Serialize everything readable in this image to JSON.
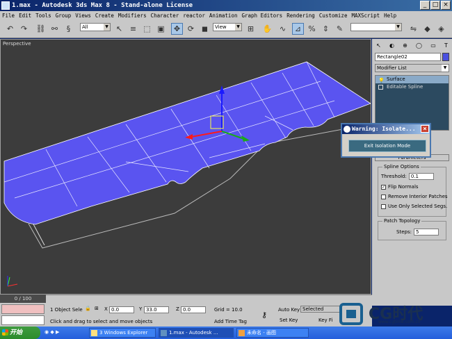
{
  "window": {
    "title": "1.max  - Autodesk 3ds Max 8  - Stand-alone License"
  },
  "menu": [
    "File",
    "Edit",
    "Tools",
    "Group",
    "Views",
    "Create",
    "Modifiers",
    "Character",
    "reactor",
    "Animation",
    "Graph Editors",
    "Rendering",
    "Customize",
    "MAXScript",
    "Help"
  ],
  "toolbar": {
    "selection_filter": "All",
    "ref_coord": "View"
  },
  "viewport": {
    "label": "Perspective"
  },
  "command_panel": {
    "object_name": "Rectangle02",
    "object_color": "#4a50e0",
    "modifier_list": "Modifier List",
    "stack": [
      "Surface",
      "Editable Spline"
    ],
    "rollout": "Parameters",
    "spline_options": {
      "title": "Spline Options",
      "threshold_label": "Threshold:",
      "threshold_value": "0.1",
      "flip_normals": "Flip Normals",
      "remove_interior": "Remove Interior Patches",
      "use_only_selected": "Use Only Selected Segs."
    },
    "patch_topology": {
      "title": "Patch Topology",
      "steps_label": "Steps:",
      "steps_value": "5"
    }
  },
  "dialog": {
    "title": "Warning: Isolate...",
    "button": "Exit Isolation Mode"
  },
  "status": {
    "time": "0 / 100",
    "selection": "1 Object Sele",
    "x_label": "X",
    "x": "0.0",
    "y_label": "Y",
    "y": "33.0",
    "z_label": "Z",
    "z": "0.0",
    "grid": "Grid = 10.0",
    "prompt": "Click and drag to select and move objects",
    "add_time_tag": "Add Time Tag",
    "auto_key": "Auto Key",
    "set_key": "Set Key",
    "selected": "Selected",
    "key_filters": "Key Fi"
  },
  "taskbar": {
    "start": "开始",
    "tasks": [
      "3 Windows Explorer",
      "1.max - Autodesk ...",
      "未命名 - 画图"
    ]
  },
  "watermark": {
    "brand": "CG时代",
    "url": "www.cgtime.com.cn"
  }
}
